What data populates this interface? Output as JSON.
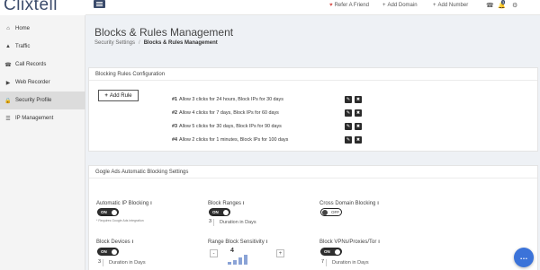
{
  "brand": {
    "logo_text": "Clixtell"
  },
  "sidebar": {
    "items": [
      {
        "label": "Home",
        "icon": "home-icon",
        "glyph": "⌂"
      },
      {
        "label": "Traffic",
        "icon": "traffic-icon",
        "glyph": "▲"
      },
      {
        "label": "Call Records",
        "icon": "phone-icon",
        "glyph": "☎"
      },
      {
        "label": "Web Recorder",
        "icon": "play-icon",
        "glyph": "▶"
      },
      {
        "label": "Security Profile",
        "icon": "lock-icon",
        "glyph": "🔒",
        "active": true
      },
      {
        "label": "IP Management",
        "icon": "list-icon",
        "glyph": "☰"
      }
    ]
  },
  "topbar": {
    "refer": "Refer A Friend",
    "add_domain": "Add Domain",
    "add_number": "Add Number",
    "notification_count": "3",
    "icons": {
      "heart": "♥",
      "plus": "+",
      "phone": "☎",
      "bell": "🔔",
      "gear": "⚙"
    }
  },
  "header": {
    "title": "Blocks & Rules Management",
    "breadcrumb": [
      "Security Settings",
      "Blocks & Rules Management"
    ]
  },
  "blocking_rules": {
    "title": "Blocking Rules Configuration",
    "add_label": "Add Rule",
    "rules": [
      {
        "num": "#1",
        "text": "Allow 3 clicks for 24 hours, Block IPs for 30 days"
      },
      {
        "num": "#2",
        "text": "Allow 4 clicks for 7 days, Block IPs for 60 days"
      },
      {
        "num": "#3",
        "text": "Allow 5 clicks for 30 days, Block IPs for 90 days"
      },
      {
        "num": "#4",
        "text": "Allow 2 clicks for 1 minutes, Block IPs for 100 days"
      }
    ],
    "edit_glyph": "✎",
    "delete_glyph": "✖"
  },
  "google_ads": {
    "title": "Gogle Ads Automatic Blocking Settings",
    "auto_ip_blocking": {
      "label": "Automatic IP Blocking",
      "state": "ON",
      "note": "* Requires Google Ads integration"
    },
    "block_ranges": {
      "label": "Block Ranges",
      "state": "ON",
      "duration": "3",
      "duration_label": "Duration in Days"
    },
    "cross_domain": {
      "label": "Cross Domain Blocking",
      "state": "OFF"
    },
    "block_devices": {
      "label": "Block Devices",
      "state": "ON",
      "duration": "3",
      "duration_label": "Duration in Days"
    },
    "range_sensitivity": {
      "label": "Range Block Sensitivity",
      "value": "4",
      "level": 4,
      "max": 4,
      "minus": "-",
      "plus": "+"
    },
    "block_vpn": {
      "label": "Block VPNs/Proxies/Tor",
      "state": "ON",
      "duration": "7",
      "duration_label": "Duration in Days"
    },
    "info_glyph": "i"
  },
  "chat": {
    "glyph": "…"
  }
}
